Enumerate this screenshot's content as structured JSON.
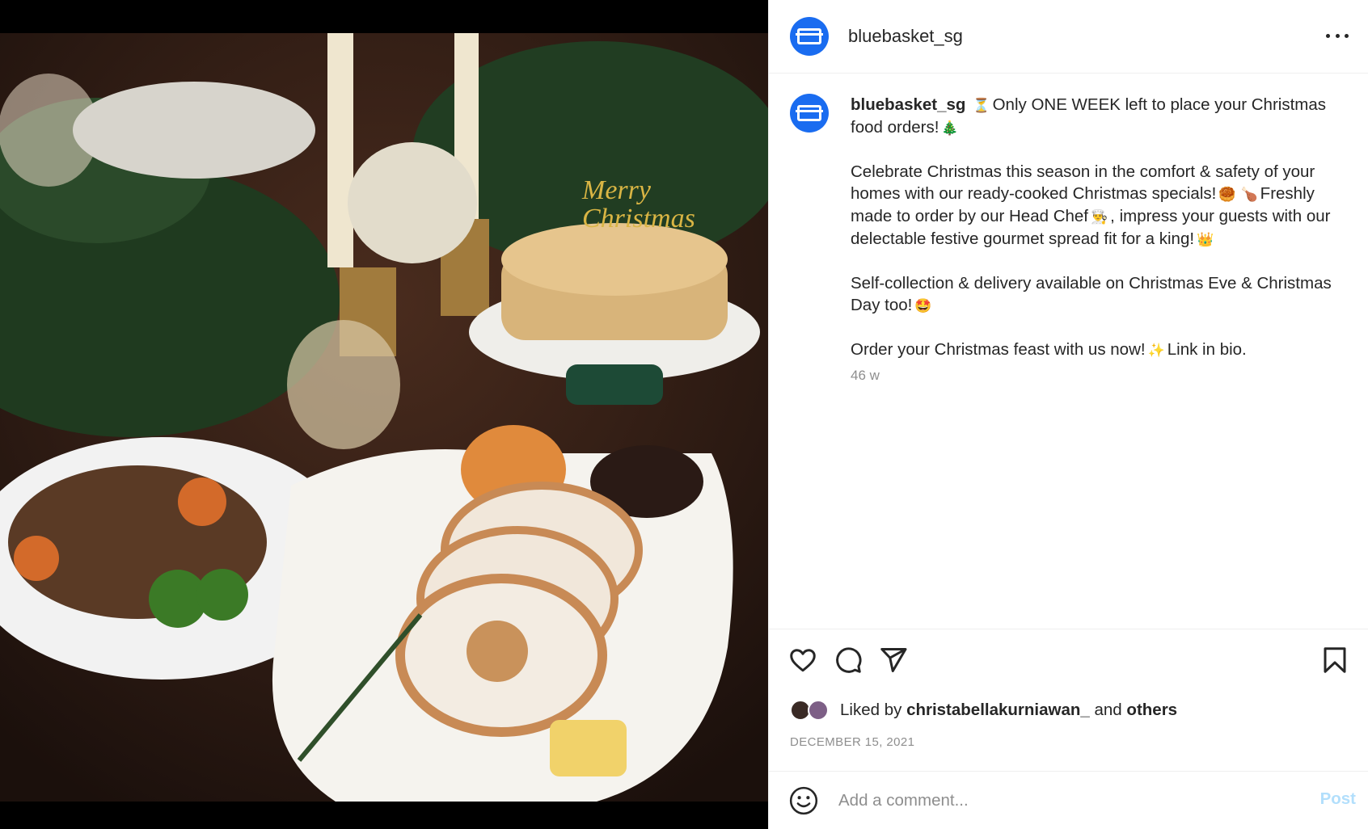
{
  "post": {
    "username": "bluebasket_sg",
    "more_label": "...",
    "caption": {
      "line1": "Only ONE WEEK left to place your Christmas food orders!",
      "para2_a": "Celebrate Christmas this season in the comfort & safety of your homes with our ready-cooked Christmas specials!",
      "para2_b": "Freshly made to order by our Head Chef",
      "para2_c": ", impress your guests with our delectable festive gourmet spread fit for a king!",
      "para3": "Self-collection & delivery available on Christmas Eve & Christmas Day too!",
      "para4_a": "Order your Christmas feast with us now!",
      "para4_b": "Link in bio."
    },
    "emojis": {
      "hourglass": "⏳",
      "tree": "🎄",
      "cookie": "🥮",
      "drumstick": "🍗",
      "chef": "👨‍🍳",
      "crown": "👑",
      "star_eyes": "🤩",
      "sparkles": "✨"
    },
    "age": "46 w",
    "likes": {
      "prefix": "Liked by",
      "user": "christabellakurniawan_",
      "and": "and",
      "others": "others"
    },
    "date": "DECEMBER 15, 2021",
    "comment": {
      "placeholder": "Add a comment...",
      "post_label": "Post"
    },
    "photo_text": "Merry Christmas"
  },
  "icons": {
    "avatar": "bluebasket-logo-icon",
    "like": "heart-icon",
    "comment": "comment-bubble-icon",
    "share": "paper-plane-icon",
    "save": "bookmark-icon",
    "emoji": "smiley-icon",
    "more": "more-options-icon"
  },
  "colors": {
    "accent": "#0095f6",
    "post_disabled": "#b2dffc",
    "avatar_bg": "#1a6cf0",
    "muted": "#8e8e8e",
    "text": "#262626"
  }
}
